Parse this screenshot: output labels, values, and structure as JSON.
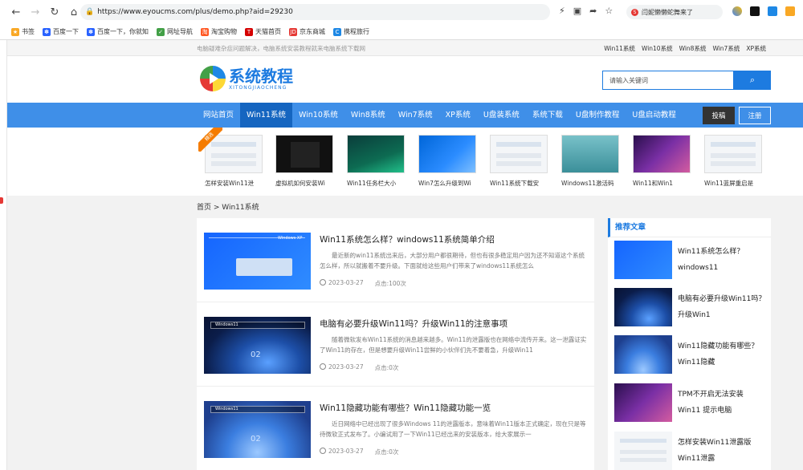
{
  "browser": {
    "url": "https://www.eyoucms.com/plus/demo.php?aid=29230",
    "search_hint": "闫妮懒懒蛇舞来了",
    "bookmarks": [
      "书签",
      "百度一下",
      "百度一下，你就知",
      "网址导航",
      "淘宝购物",
      "天猫首页",
      "京东商城",
      "携程旅行"
    ]
  },
  "topbar": {
    "notice": "电脑疑难杂症问题解决，电脑系统安装教程就来电脑系统下载网",
    "quick_links": [
      "Win11系统",
      "Win10系统",
      "Win8系统",
      "Win7系统",
      "XP系统"
    ]
  },
  "header": {
    "logo_cn": "系统教程",
    "logo_en": "XITONGJIAOCHENG",
    "search_placeholder": "请输入关键词"
  },
  "nav": {
    "items": [
      "网站首页",
      "Win11系统",
      "Win10系统",
      "Win8系统",
      "Win7系统",
      "XP系统",
      "U盘装系统",
      "系统下载",
      "U盘制作教程",
      "U盘启动教程"
    ],
    "active_index": 1,
    "submit_label": "投稿",
    "register_label": "注册"
  },
  "thumbs": {
    "ribbon": "精选",
    "items": [
      "怎样安装Win11泄",
      "虚拟机如何安装Wi",
      "Win11任务栏大小",
      "Win7怎么升级到Wi",
      "Win11系统下载安",
      "Windows11激活码",
      "Win11和Win1",
      "Win11蓝屏重启是"
    ]
  },
  "breadcrumb": "首页 > Win11系统",
  "articles": [
    {
      "title": "Win11系统怎么样？windows11系统简单介绍",
      "desc": "最近新的win11系统出来后，大部分用户都很期待，但也有很多稳定用户因为还不知道这个系统怎么样，所以就搬着不要升级。下面就给这些用户们带来了windows11系统怎么",
      "date": "2023-03-27",
      "clicks": "点击:100次"
    },
    {
      "title": "电脑有必要升级Win11吗？升级Win11的注意事项",
      "desc": "随着微软发布Win11系统的消息越来越多。Win11的泄露版也在网络中流传开来。这一泄露证实了Win11的存在，但是想要升级Win11尝鲜的小伙伴们先不要着急，升级Win11",
      "date": "2023-03-27",
      "clicks": "点击:0次"
    },
    {
      "title": "Win11隐藏功能有哪些？Win11隐藏功能一览",
      "desc": "近日网络中已经出现了很多Windows 11的泄露版本，意味着Win11版本正式确定，现在只是等待微软正式发布了。小编试用了一下Win11已经出来的安装版本，给大家展示一",
      "date": "2023-03-27",
      "clicks": "点击:0次"
    }
  ],
  "sidebar": {
    "heading": "推荐文章",
    "items": [
      "Win11系统怎么样？windows11",
      "电脑有必要升级Win11吗？升级Win1",
      "Win11隐藏功能有哪些？Win11隐藏",
      "TPM不开启无法安装Win11 提示电脑",
      "怎样安装Win11泄露版 Win11泄露"
    ]
  },
  "image_text": {
    "xp_caption": "Windows XP",
    "win11_caption": "Windows11",
    "version_label": "02"
  }
}
